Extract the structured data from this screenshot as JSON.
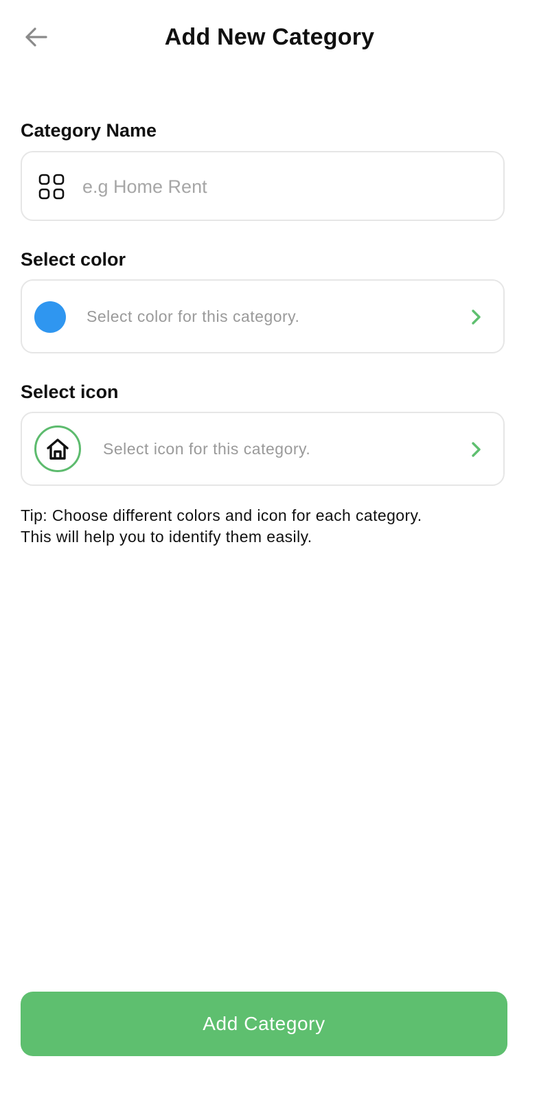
{
  "header": {
    "title": "Add New Category",
    "back_icon": "arrow-left-icon"
  },
  "form": {
    "name": {
      "label": "Category Name",
      "placeholder": "e.g Home Rent",
      "value": "",
      "icon": "grid-icon"
    },
    "color": {
      "label": "Select color",
      "hint": "Select color for this category.",
      "selected_color": "#2f96f0",
      "chevron_icon": "chevron-right-icon"
    },
    "icon": {
      "label": "Select icon",
      "hint": "Select icon for this category.",
      "selected_icon": "home-icon",
      "chevron_icon": "chevron-right-icon"
    }
  },
  "tip": {
    "line1": "Tip: Choose different colors and icon for each category.",
    "line2": "This will help you to identify them easily."
  },
  "submit": {
    "label": "Add Category"
  },
  "colors": {
    "accent": "#5ebf6f",
    "border": "#e6e6e6",
    "placeholder": "#a6a6a6",
    "back_arrow": "#8a8a8a"
  }
}
